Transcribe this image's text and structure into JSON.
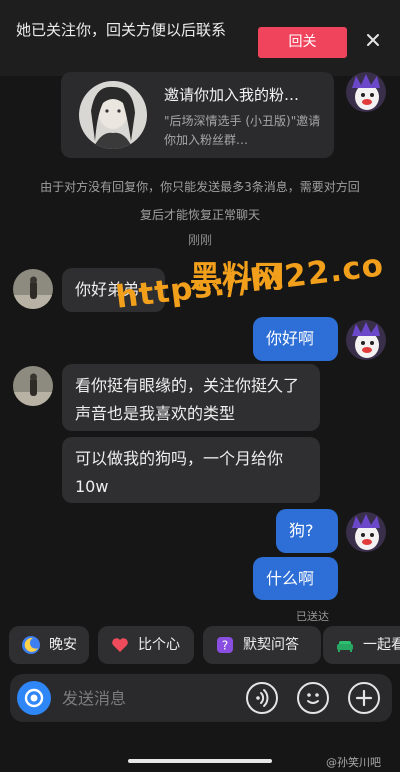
{
  "banner": {
    "text": "她已关注你，回关方便以后联系",
    "follow_back": "回关"
  },
  "invite_card": {
    "title": "邀请你加入我的粉…",
    "desc": "\"后场深情选手 (小丑版)\"邀请你加入粉丝群…"
  },
  "system_note": "由于对方没有回复你，你只能发送最多3条消息，需要对方回复后才能恢复正常聊天",
  "timestamp": "刚刚",
  "messages": [
    {
      "from": "her",
      "text": "你好弟弟"
    },
    {
      "from": "me",
      "text": "你好啊"
    },
    {
      "from": "her",
      "text": "看你挺有眼缘的，关注你挺久了声音也是我喜欢的类型"
    },
    {
      "from": "her",
      "text": "可以做我的狗吗，一个月给你 10w"
    },
    {
      "from": "me",
      "text": "狗?"
    },
    {
      "from": "me",
      "text": "什么啊"
    }
  ],
  "read_status": "已送达",
  "watermark": {
    "line1": "黑料网",
    "line2": "https://hl22.co"
  },
  "quick_replies": [
    "晚安",
    "比个心",
    "默契问答",
    "一起看"
  ],
  "input": {
    "placeholder": "发送消息"
  },
  "credit": "@孙笑川吧",
  "colors": {
    "accent_red": "#f0445d",
    "my_bubble": "#2d6fd6",
    "her_bubble": "#2f2f31",
    "watermark": "#f2a01c"
  }
}
